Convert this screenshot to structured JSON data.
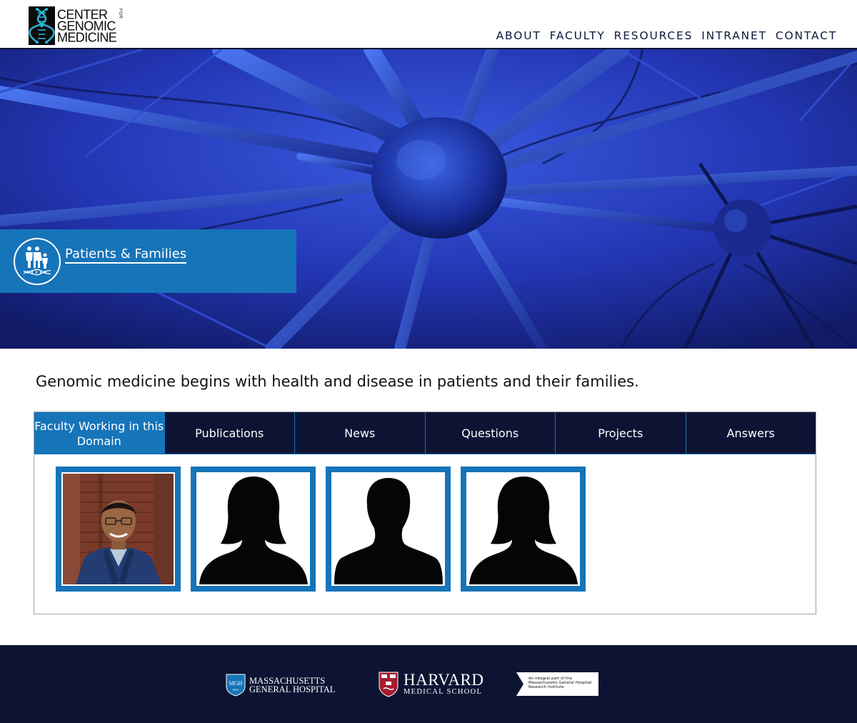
{
  "header": {
    "logo_line1": "CENTER",
    "logo_for": "FOR",
    "logo_line2": "GENOMIC",
    "logo_line3": "MEDICINE",
    "nav": [
      "ABOUT",
      "FACULTY",
      "RESOURCES",
      "INTRANET",
      "CONTACT"
    ]
  },
  "hero": {
    "domain_title": "Patients & Families",
    "domain_icon": "family-dna-icon"
  },
  "intro": "Genomic medicine begins with health and disease in patients and their families.",
  "tabs": [
    {
      "label": "Faculty Working in this Domain",
      "active": true
    },
    {
      "label": "Publications",
      "active": false
    },
    {
      "label": "News",
      "active": false
    },
    {
      "label": "Questions",
      "active": false
    },
    {
      "label": "Projects",
      "active": false
    },
    {
      "label": "Answers",
      "active": false
    }
  ],
  "faculty": [
    {
      "type": "photo"
    },
    {
      "type": "silhouette-female"
    },
    {
      "type": "silhouette-male"
    },
    {
      "type": "silhouette-female"
    }
  ],
  "footer": {
    "mgh_line1": "MASSACHUSETTS",
    "mgh_line2": "GENERAL HOSPITAL",
    "mgh_seal": "MGH",
    "mgh_year": "1811",
    "hms_line1": "HARVARD",
    "hms_line2": "MEDICAL SCHOOL",
    "mgri_text": "An integral part of the Massachusetts General Hospital Research Institute"
  },
  "colors": {
    "navy": "#0d1433",
    "accent_blue": "#1674b9",
    "hero_blue": "#2a3fbf"
  }
}
